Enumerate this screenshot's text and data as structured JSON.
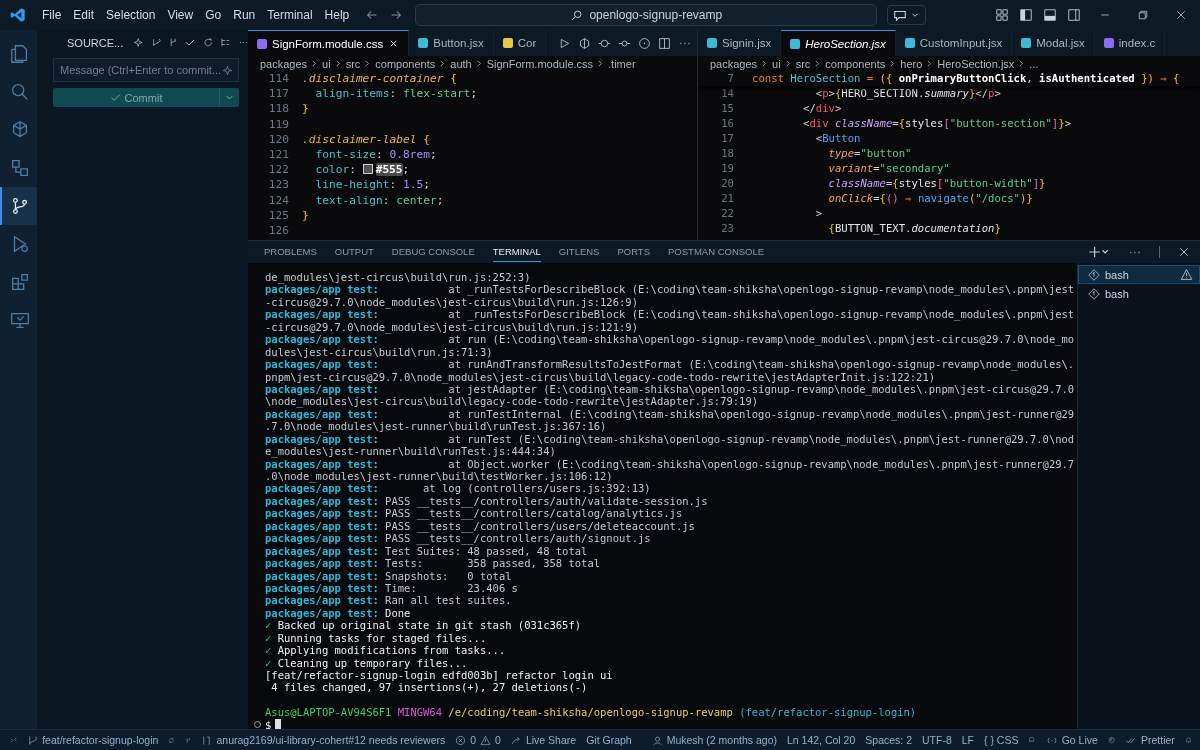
{
  "menu": [
    "File",
    "Edit",
    "Selection",
    "View",
    "Go",
    "Run",
    "Terminal",
    "Help"
  ],
  "command_center": "openlogo-signup-revamp",
  "activity_bar": [
    {
      "selected": false
    },
    {
      "selected": false
    },
    {
      "selected": false
    },
    {
      "selected": false
    },
    {
      "selected": true
    },
    {
      "selected": false
    },
    {
      "selected": false
    },
    {
      "selected": false
    }
  ],
  "sidebar": {
    "title": "SOURCE...",
    "message_placeholder": "Message (Ctrl+Enter to commit...",
    "commit_button": "Commit"
  },
  "editor_left": {
    "tabs": [
      {
        "label": "SignForm.module.css",
        "kind": "css",
        "selected": true,
        "preview": false
      },
      {
        "label": "Button.jsx",
        "kind": "react",
        "selected": false,
        "preview": false
      },
      {
        "label": "Cor",
        "kind": "js",
        "selected": false,
        "preview": false
      }
    ],
    "breadcrumbs": [
      "packages",
      "ui",
      "src",
      "components",
      "auth",
      "SignForm.module.css",
      ".timer"
    ],
    "lines": [
      {
        "number": "114",
        "tokens": [
          {
            "text": ".disclaimer-container",
            "kind": "sel"
          },
          {
            "text": " {",
            "kind": "brace"
          }
        ]
      },
      {
        "number": "117",
        "tokens": [
          {
            "text": "  align-items",
            "kind": "prop"
          },
          {
            "text": ": ",
            "kind": "punct"
          },
          {
            "text": "flex-start",
            "kind": "str"
          },
          {
            "text": ";",
            "kind": "punct"
          }
        ]
      },
      {
        "number": "118",
        "tokens": [
          {
            "text": "}",
            "kind": "brace"
          }
        ]
      },
      {
        "number": "119"
      },
      {
        "number": "120",
        "tokens": [
          {
            "text": ".disclaimer-label",
            "kind": "sel"
          },
          {
            "text": " {",
            "kind": "brace"
          }
        ]
      },
      {
        "number": "121",
        "tokens": [
          {
            "text": "  font-size",
            "kind": "prop"
          },
          {
            "text": ": ",
            "kind": "punct"
          },
          {
            "text": "0.8rem",
            "kind": "num"
          },
          {
            "text": ";",
            "kind": "punct"
          }
        ]
      },
      {
        "number": "122",
        "tokens": [
          {
            "text": "  color",
            "kind": "prop"
          },
          {
            "text": ": ",
            "kind": "punct"
          },
          {
            "text": "#555",
            "kind": "hex"
          },
          {
            "text": ";",
            "kind": "punct"
          }
        ]
      },
      {
        "number": "123",
        "tokens": [
          {
            "text": "  line-height",
            "kind": "prop"
          },
          {
            "text": ": ",
            "kind": "punct"
          },
          {
            "text": "1.5",
            "kind": "num"
          },
          {
            "text": ";",
            "kind": "punct"
          }
        ]
      },
      {
        "number": "124",
        "tokens": [
          {
            "text": "  text-align",
            "kind": "prop"
          },
          {
            "text": ": ",
            "kind": "punct"
          },
          {
            "text": "center",
            "kind": "str"
          },
          {
            "text": ";",
            "kind": "punct"
          }
        ]
      },
      {
        "number": "125",
        "tokens": [
          {
            "text": "}",
            "kind": "brace"
          }
        ]
      },
      {
        "number": "126"
      }
    ]
  },
  "editor_right": {
    "tabs": [
      {
        "label": "Signin.jsx",
        "kind": "react",
        "selected": false,
        "preview": false
      },
      {
        "label": "HeroSection.jsx",
        "kind": "react",
        "selected": true,
        "preview": true
      },
      {
        "label": "CustomInput.jsx",
        "kind": "react",
        "selected": false,
        "preview": false
      },
      {
        "label": "Modal.jsx",
        "kind": "react",
        "selected": false,
        "preview": false
      },
      {
        "label": "index.c",
        "kind": "css",
        "selected": false,
        "preview": false
      }
    ],
    "breadcrumbs": [
      "packages",
      "ui",
      "src",
      "components",
      "hero",
      "HeroSection.jsx",
      "..."
    ],
    "sticky_line": {
      "number": "7",
      "tokens": [
        {
          "text": "const ",
          "kind": "kw"
        },
        {
          "text": "HeroSection ",
          "kind": "fn"
        },
        {
          "text": "= ",
          "kind": "kw"
        },
        {
          "text": "({ ",
          "kind": "brace"
        },
        {
          "text": "onPrimaryButtonClick",
          "kind": "param"
        },
        {
          "text": ", ",
          "kind": "punct"
        },
        {
          "text": "isAuthenticated ",
          "kind": "param"
        },
        {
          "text": "}) ",
          "kind": "brace"
        },
        {
          "text": "⇒ ",
          "kind": "kw"
        },
        {
          "text": "{",
          "kind": "brace"
        }
      ]
    },
    "lines": [
      {
        "number": "14",
        "tokens": [
          {
            "text": "          <",
            "kind": "punct"
          },
          {
            "text": "p",
            "kind": "tag"
          },
          {
            "text": ">",
            "kind": "punct"
          },
          {
            "text": "{",
            "kind": "brace"
          },
          {
            "text": "HERO_SECTION",
            "kind": "ident"
          },
          {
            "text": ".",
            "kind": "punct"
          },
          {
            "text": "summary",
            "kind": "italic"
          },
          {
            "text": "}",
            "kind": "brace"
          },
          {
            "text": "</",
            "kind": "punct"
          },
          {
            "text": "p",
            "kind": "tag"
          },
          {
            "text": ">",
            "kind": "punct"
          }
        ]
      },
      {
        "number": "15",
        "tokens": [
          {
            "text": "        </",
            "kind": "punct"
          },
          {
            "text": "div",
            "kind": "tag"
          },
          {
            "text": ">",
            "kind": "punct"
          }
        ]
      },
      {
        "number": "16",
        "tokens": [
          {
            "text": "        <",
            "kind": "punct"
          },
          {
            "text": "div ",
            "kind": "tag"
          },
          {
            "text": "className",
            "kind": "attr2"
          },
          {
            "text": "=",
            "kind": "punct"
          },
          {
            "text": "{",
            "kind": "brace"
          },
          {
            "text": "styles",
            "kind": "ident"
          },
          {
            "text": "[",
            "kind": "bracket"
          },
          {
            "text": "\"button-section\"",
            "kind": "str"
          },
          {
            "text": "]",
            "kind": "bracket"
          },
          {
            "text": "}",
            "kind": "brace"
          },
          {
            "text": ">",
            "kind": "punct"
          }
        ]
      },
      {
        "number": "17",
        "tokens": [
          {
            "text": "          <",
            "kind": "punct"
          },
          {
            "text": "Button",
            "kind": "comp"
          }
        ]
      },
      {
        "number": "18",
        "tokens": [
          {
            "text": "            type",
            "kind": "attr"
          },
          {
            "text": "=",
            "kind": "punct"
          },
          {
            "text": "\"button\"",
            "kind": "str"
          }
        ]
      },
      {
        "number": "19",
        "tokens": [
          {
            "text": "            variant",
            "kind": "attr"
          },
          {
            "text": "=",
            "kind": "punct"
          },
          {
            "text": "\"secondary\"",
            "kind": "str"
          }
        ]
      },
      {
        "number": "20",
        "tokens": [
          {
            "text": "            className",
            "kind": "attr2"
          },
          {
            "text": "=",
            "kind": "punct"
          },
          {
            "text": "{",
            "kind": "brace"
          },
          {
            "text": "styles",
            "kind": "ident"
          },
          {
            "text": "[",
            "kind": "bracket"
          },
          {
            "text": "\"button-width\"",
            "kind": "str"
          },
          {
            "text": "]",
            "kind": "bracket"
          },
          {
            "text": "}",
            "kind": "brace"
          }
        ]
      },
      {
        "number": "21",
        "tokens": [
          {
            "text": "            onClick",
            "kind": "attr"
          },
          {
            "text": "=",
            "kind": "punct"
          },
          {
            "text": "{",
            "kind": "brace"
          },
          {
            "text": "() ",
            "kind": "bracket"
          },
          {
            "text": "⇒ ",
            "kind": "kw"
          },
          {
            "text": "navigate",
            "kind": "call"
          },
          {
            "text": "(",
            "kind": "brace"
          },
          {
            "text": "\"/docs\"",
            "kind": "str"
          },
          {
            "text": ")",
            "kind": "brace"
          },
          {
            "text": "}",
            "kind": "brace"
          }
        ]
      },
      {
        "number": "22",
        "tokens": [
          {
            "text": "          >",
            "kind": "punct"
          }
        ]
      },
      {
        "number": "23",
        "tokens": [
          {
            "text": "            {",
            "kind": "brace"
          },
          {
            "text": "BUTTON_TEXT",
            "kind": "ident"
          },
          {
            "text": ".",
            "kind": "punct"
          },
          {
            "text": "documentation",
            "kind": "italic"
          },
          {
            "text": "}",
            "kind": "brace"
          }
        ]
      }
    ]
  },
  "panel": {
    "tabs": [
      {
        "label": "PROBLEMS",
        "selected": false
      },
      {
        "label": "OUTPUT",
        "selected": false
      },
      {
        "label": "DEBUG CONSOLE",
        "selected": false
      },
      {
        "label": "TERMINAL",
        "selected": true
      },
      {
        "label": "GITLENS",
        "selected": false
      },
      {
        "label": "PORTS",
        "selected": false
      },
      {
        "label": "POSTMAN CONSOLE",
        "selected": false
      }
    ],
    "terminal": [
      {
        "kind": "plain",
        "text": "de_modules\\jest-circus\\build\\run.js:252:3)"
      },
      {
        "kind": "log",
        "prefix": "packages/app test:",
        "text": "           at _runTestsForDescribeBlock (E:\\coding\\team-shiksha\\openlogo-signup-revamp\\node_modules\\.pnpm\\jest"
      },
      {
        "kind": "plain",
        "text": "-circus@29.7.0\\node_modules\\jest-circus\\build\\run.js:126:9)"
      },
      {
        "kind": "log",
        "prefix": "packages/app test:",
        "text": "           at _runTestsForDescribeBlock (E:\\coding\\team-shiksha\\openlogo-signup-revamp\\node_modules\\.pnpm\\jest"
      },
      {
        "kind": "plain",
        "text": "-circus@29.7.0\\node_modules\\jest-circus\\build\\run.js:121:9)"
      },
      {
        "kind": "log",
        "prefix": "packages/app test:",
        "text": "           at run (E:\\coding\\team-shiksha\\openlogo-signup-revamp\\node_modules\\.pnpm\\jest-circus@29.7.0\\node_mo"
      },
      {
        "kind": "plain",
        "text": "dules\\jest-circus\\build\\run.js:71:3)"
      },
      {
        "kind": "log",
        "prefix": "packages/app test:",
        "text": "           at runAndTransformResultsToJestFormat (E:\\coding\\team-shiksha\\openlogo-signup-revamp\\node_modules\\."
      },
      {
        "kind": "plain",
        "text": "pnpm\\jest-circus@29.7.0\\node_modules\\jest-circus\\build\\legacy-code-todo-rewrite\\jestAdapterInit.js:122:21)"
      },
      {
        "kind": "log",
        "prefix": "packages/app test:",
        "text": "           at jestAdapter (E:\\coding\\team-shiksha\\openlogo-signup-revamp\\node_modules\\.pnpm\\jest-circus@29.7.0"
      },
      {
        "kind": "plain",
        "text": "\\node_modules\\jest-circus\\build\\legacy-code-todo-rewrite\\jestAdapter.js:79:19)"
      },
      {
        "kind": "log",
        "prefix": "packages/app test:",
        "text": "           at runTestInternal (E:\\coding\\team-shiksha\\openlogo-signup-revamp\\node_modules\\.pnpm\\jest-runner@29"
      },
      {
        "kind": "plain",
        "text": ".7.0\\node_modules\\jest-runner\\build\\runTest.js:367:16)"
      },
      {
        "kind": "log",
        "prefix": "packages/app test:",
        "text": "           at runTest (E:\\coding\\team-shiksha\\openlogo-signup-revamp\\node_modules\\.pnpm\\jest-runner@29.7.0\\nod"
      },
      {
        "kind": "plain",
        "text": "e_modules\\jest-runner\\build\\runTest.js:444:34)"
      },
      {
        "kind": "log",
        "prefix": "packages/app test:",
        "text": "           at Object.worker (E:\\coding\\team-shiksha\\openlogo-signup-revamp\\node_modules\\.pnpm\\jest-runner@29.7"
      },
      {
        "kind": "plain",
        "text": ".0\\node_modules\\jest-runner\\build\\testWorker.js:106:12)"
      },
      {
        "kind": "log",
        "prefix": "packages/app test:",
        "text": "       at log (controllers/users.js:392:13)"
      },
      {
        "kind": "log",
        "prefix": "packages/app test:",
        "text": " PASS __tests__/controllers/auth/validate-session.js"
      },
      {
        "kind": "log",
        "prefix": "packages/app test:",
        "text": " PASS __tests__/controllers/catalog/analytics.js"
      },
      {
        "kind": "log",
        "prefix": "packages/app test:",
        "text": " PASS __tests__/controllers/users/deleteaccount.js"
      },
      {
        "kind": "log",
        "prefix": "packages/app test:",
        "text": " PASS __tests__/controllers/auth/signout.js"
      },
      {
        "kind": "log",
        "prefix": "packages/app test:",
        "text": " Test Suites: 48 passed, 48 total"
      },
      {
        "kind": "log",
        "prefix": "packages/app test:",
        "text": " Tests:       358 passed, 358 total"
      },
      {
        "kind": "log",
        "prefix": "packages/app test:",
        "text": " Snapshots:   0 total"
      },
      {
        "kind": "log",
        "prefix": "packages/app test:",
        "text": " Time:        23.406 s"
      },
      {
        "kind": "log",
        "prefix": "packages/app test:",
        "text": " Ran all test suites."
      },
      {
        "kind": "log_bright",
        "prefix": "packages/app test:",
        "text": " Done"
      },
      {
        "kind": "check",
        "mark": "✓",
        "text": " Backed up original state in git stash (031c365f)"
      },
      {
        "kind": "check",
        "mark": "✓",
        "text": " Running tasks for staged files..."
      },
      {
        "kind": "check",
        "mark": "✓",
        "text": " Applying modifications from tasks..."
      },
      {
        "kind": "check",
        "mark": "✓",
        "text": " Cleaning up temporary files..."
      },
      {
        "kind": "plain_bright",
        "text": "[feat/refactor-signup-login edfd003b] refactor login ui"
      },
      {
        "kind": "plain_bright",
        "text": " 4 files changed, 97 insertions(+), 27 deletions(-)"
      },
      {
        "kind": "blank"
      },
      {
        "kind": "prompt",
        "user": "Asus@LAPTOP-AV94S6F1",
        "shell": "MINGW64",
        "path": "/e/coding/team-shiksha/openlogo-signup-revamp",
        "branch": "(feat/refactor-signup-login)"
      },
      {
        "kind": "input",
        "symbol": "$"
      }
    ],
    "terminal_list": [
      {
        "label": "bash",
        "selected": true,
        "warning": true
      },
      {
        "label": "bash",
        "selected": false,
        "warning": false
      }
    ]
  },
  "status_bar": {
    "branch": "feat/refactor-signup-login",
    "pull_request": "anurag2169/ui-library-cohert#12 needs reviewers",
    "errors": "0",
    "warnings": "0",
    "live_share": "Live Share",
    "git_graph": "Git Graph",
    "blame": "Mukesh (2 months ago)",
    "cursor": "Ln 142, Col 20",
    "indent": "Spaces: 2",
    "encoding": "UTF-8",
    "eol": "LF",
    "language": "{ } CSS",
    "go_live": "Go Live",
    "formatter": "Prettier"
  }
}
